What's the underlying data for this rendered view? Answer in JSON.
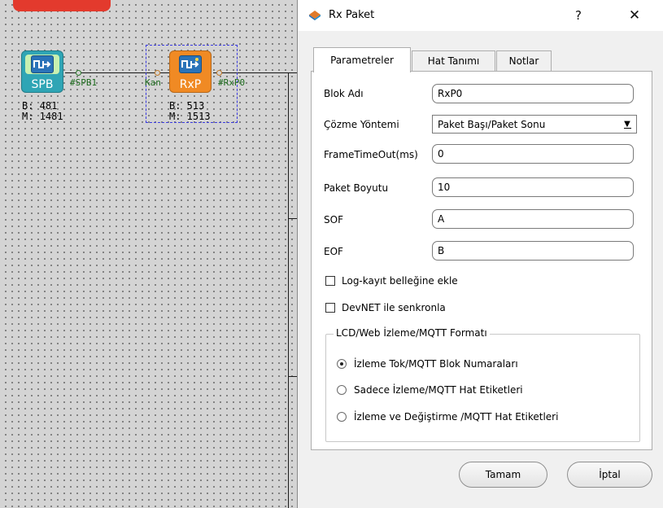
{
  "canvas": {
    "blocks": [
      {
        "name": "SPB",
        "pin_label": "#SPB1",
        "b": "B: 481",
        "m": "M: 1481"
      },
      {
        "name": "RxP",
        "in_label": "Kan",
        "pin_label": "#RxP0",
        "b": "B: 513",
        "m": "M: 1513"
      }
    ]
  },
  "dialog": {
    "title": "Rx Paket",
    "help": "?",
    "close": "✕",
    "tabs": [
      "Parametreler",
      "Hat Tanımı",
      "Notlar"
    ],
    "fields": {
      "blok_adi": {
        "label": "Blok Adı",
        "value": "RxP0"
      },
      "cozme_yontemi": {
        "label": "Çözme Yöntemi",
        "value": "Paket Başı/Paket Sonu"
      },
      "frame_timeout": {
        "label": "FrameTimeOut(ms)",
        "value": "0"
      },
      "paket_boyutu": {
        "label": "Paket Boyutu",
        "value": "10"
      },
      "sof": {
        "label": "SOF",
        "value": "A"
      },
      "eof": {
        "label": "EOF",
        "value": "B"
      }
    },
    "checkboxes": {
      "log": {
        "label": "Log-kayıt belleğine ekle",
        "checked": false
      },
      "devnet": {
        "label": "DevNET ile senkronla",
        "checked": false
      }
    },
    "group": {
      "title": "LCD/Web İzleme/MQTT Formatı",
      "options": [
        {
          "label": "İzleme Tok/MQTT Blok Numaraları",
          "selected": true
        },
        {
          "label": "Sadece İzleme/MQTT Hat Etiketleri",
          "selected": false
        },
        {
          "label": "İzleme ve Değiştirme /MQTT Hat Etiketleri",
          "selected": false
        }
      ]
    },
    "buttons": {
      "ok": "Tamam",
      "cancel": "İptal"
    }
  }
}
